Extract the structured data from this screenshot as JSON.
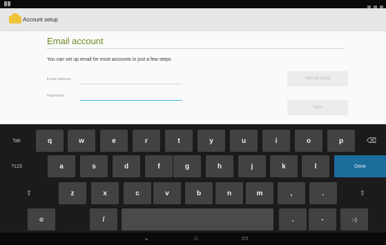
{
  "action_bar": {
    "title": "Account setup"
  },
  "page": {
    "heading": "Email account",
    "description": "You can set up email for most accounts in just a few steps.",
    "email_label": "Email address",
    "password_label": "Password",
    "manual_button": "Manual setup",
    "next_button": "Next"
  },
  "keyboard": {
    "row1": [
      "Tab",
      "q",
      "w",
      "e",
      "r",
      "t",
      "y",
      "u",
      "i",
      "o",
      "p",
      "⌫"
    ],
    "row2": [
      "?123",
      "a",
      "s",
      "d",
      "f",
      "g",
      "h",
      "j",
      "k",
      "l",
      "Done"
    ],
    "row3": [
      "⇧",
      "z",
      "x",
      "c",
      "v",
      "b",
      "n",
      "m",
      ",",
      ".",
      "⇧"
    ],
    "row4": [
      "⚙",
      "/",
      "",
      ".",
      "-",
      ":-)"
    ]
  },
  "nav": {
    "back": "⌄",
    "home": "⌂",
    "recents": "▭"
  },
  "colors": {
    "accent": "#6b8a1f",
    "focus": "#33b5e5",
    "done_key": "#1c6d9b"
  }
}
